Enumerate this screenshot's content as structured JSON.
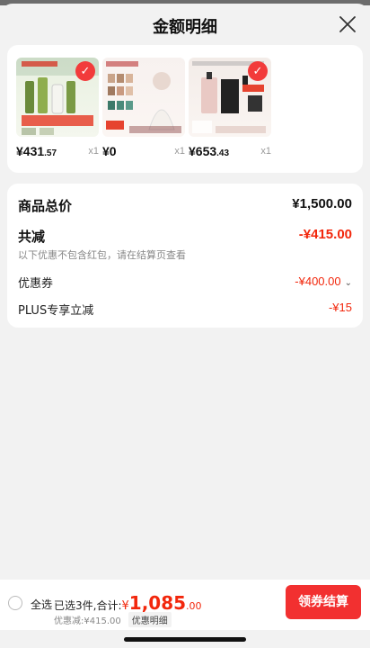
{
  "header": {
    "title": "金额明细",
    "close_icon": "close-icon"
  },
  "products": [
    {
      "price_int": "¥431",
      "price_dec": ".57",
      "qty": "x1",
      "selected": true
    },
    {
      "price_int": "¥0",
      "price_dec": "",
      "qty": "x1",
      "selected": false
    },
    {
      "price_int": "¥653",
      "price_dec": ".43",
      "qty": "x1",
      "selected": true
    }
  ],
  "summary": {
    "total_label": "商品总价",
    "total_value": "¥1,500.00",
    "reduce_label": "共减",
    "reduce_value": "-¥415.00",
    "reduce_note": "以下优惠不包含红包，请在结算页查看",
    "coupon_label": "优惠券",
    "coupon_value": "-¥400.00",
    "plus_label": "PLUS专享立减",
    "plus_value": "-¥15"
  },
  "bottom_bar": {
    "select_all": "全选",
    "selected_prefix": "已选3件,合计:",
    "total_currency": "¥",
    "total_int": "1,085",
    "total_dec": ".00",
    "discount_text": "优惠减:¥415.00",
    "detail_label": "优惠明细",
    "checkout_label": "领券结算"
  },
  "colors": {
    "accent_red": "#f2270c",
    "button_red": "#f23030"
  }
}
